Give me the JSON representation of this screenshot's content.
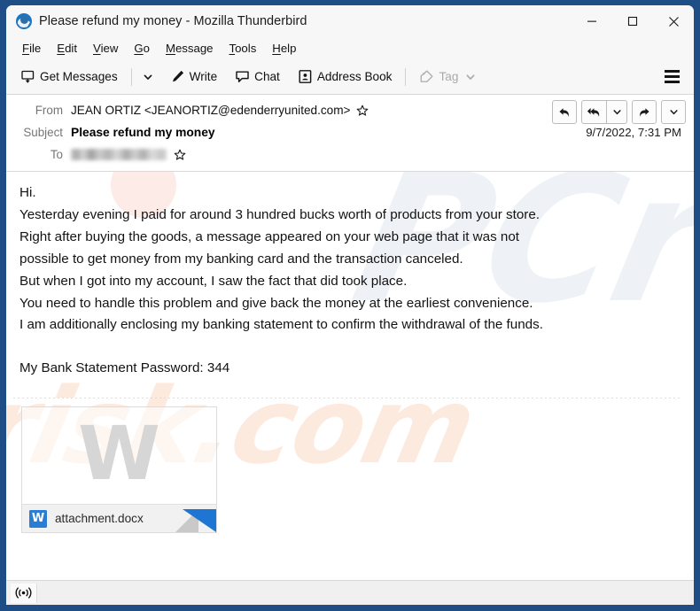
{
  "window": {
    "title": "Please refund my money - Mozilla Thunderbird",
    "app_icon": "thunderbird-icon",
    "controls": {
      "minimize": "minimize-icon",
      "maximize": "maximize-icon",
      "close": "close-icon"
    }
  },
  "menubar": {
    "items": [
      {
        "label": "File",
        "accel": "F"
      },
      {
        "label": "Edit",
        "accel": "E"
      },
      {
        "label": "View",
        "accel": "V"
      },
      {
        "label": "Go",
        "accel": "G"
      },
      {
        "label": "Message",
        "accel": "M"
      },
      {
        "label": "Tools",
        "accel": "T"
      },
      {
        "label": "Help",
        "accel": "H"
      }
    ]
  },
  "toolbar": {
    "get_messages_label": "Get Messages",
    "write_label": "Write",
    "chat_label": "Chat",
    "address_book_label": "Address Book",
    "tag_label": "Tag",
    "tag_disabled": true,
    "menu_icon": "hamburger-icon"
  },
  "message_header": {
    "from_label": "From",
    "from_value": "JEAN ORTIZ <JEANORTIZ@edenderryunited.com>",
    "subject_label": "Subject",
    "subject_value": "Please refund my money",
    "to_label": "To",
    "to_value": "",
    "date": "9/7/2022, 7:31 PM",
    "actions": {
      "reply": "reply-icon",
      "reply_all": "reply-all-icon",
      "reply_all_more": "chevron-down-icon",
      "forward": "forward-icon",
      "more": "chevron-down-icon"
    }
  },
  "body": {
    "lines": [
      "Hi.",
      "Yesterday evening I paid for around 3 hundred bucks worth of products from your store.",
      "Right after buying the goods, a message appeared on your web page that it was not",
      "possible to get money from my banking card and the transaction canceled.",
      "But when I got into my account, I saw the fact that did took place.",
      "You need to handle this problem and give back the money at the earliest convenience.",
      "I am additionally enclosing my banking statement to confirm the withdrawal of the funds."
    ],
    "password_line": "My Bank Statement Password: 344"
  },
  "attachment": {
    "filename": "attachment.docx",
    "preview_glyph": "W",
    "icon_letter": "W",
    "icon_color": "#2b7cd3"
  },
  "watermark": {
    "top_text": "PCrisk",
    "bottom_text": "risk.com",
    "top_color": "#eef2f7",
    "bottom_color": "#fdeade"
  },
  "statusbar": {
    "offline_icon": "broadcast-icon",
    "text": ""
  },
  "colors": {
    "window_border": "#1f4e87",
    "toolbar_bg": "#f7f7f7",
    "accent": "#2b7cd3"
  }
}
